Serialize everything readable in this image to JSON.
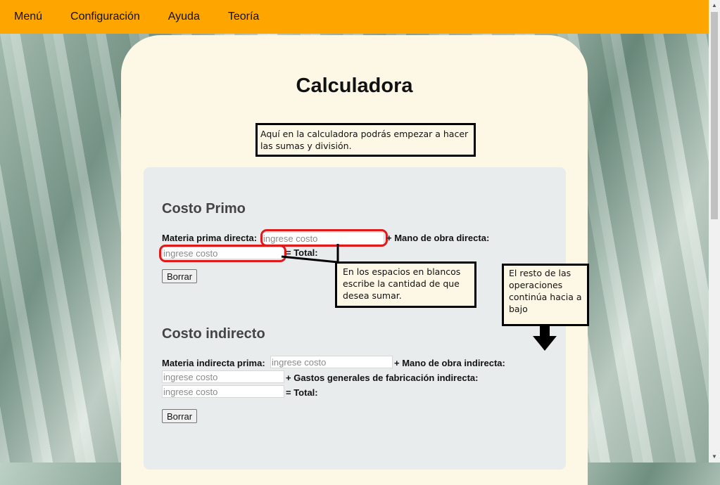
{
  "nav": {
    "items": [
      "Menú",
      "Configuración",
      "Ayuda",
      "Teoría"
    ]
  },
  "page": {
    "title": "Calculadora"
  },
  "notes": {
    "intro": "Aquí en la calculadora podrás empezar a hacer las sumas y división.",
    "blank_spaces": "En los espacios en blancos escribe la cantidad de que desea sumar.",
    "rest": "El resto de las operaciones continúa hacia a bajo"
  },
  "costo_primo": {
    "title": "Costo Primo",
    "materia_prima_label": "Materia prima directa:",
    "mano_obra_label": "+ Mano de obra directa:",
    "total_label": "= Total:",
    "placeholder": "ingrese costo",
    "borrar": "Borrar"
  },
  "costo_indirecto": {
    "title": "Costo indirecto",
    "materia_label": "Materia indirecta prima:",
    "mano_obra_label": "+ Mano de obra indirecta:",
    "gastos_label": "+ Gastos generales de fabricación indirecta:",
    "total_label": "= Total:",
    "placeholder": "ingrese costo",
    "borrar": "Borrar"
  },
  "colors": {
    "navbar": "#ffa500",
    "card": "#fdf7e5",
    "panel": "#e9ecec",
    "highlight": "#e01a1a"
  },
  "icons": {
    "down_arrow": "arrow-down-icon"
  }
}
